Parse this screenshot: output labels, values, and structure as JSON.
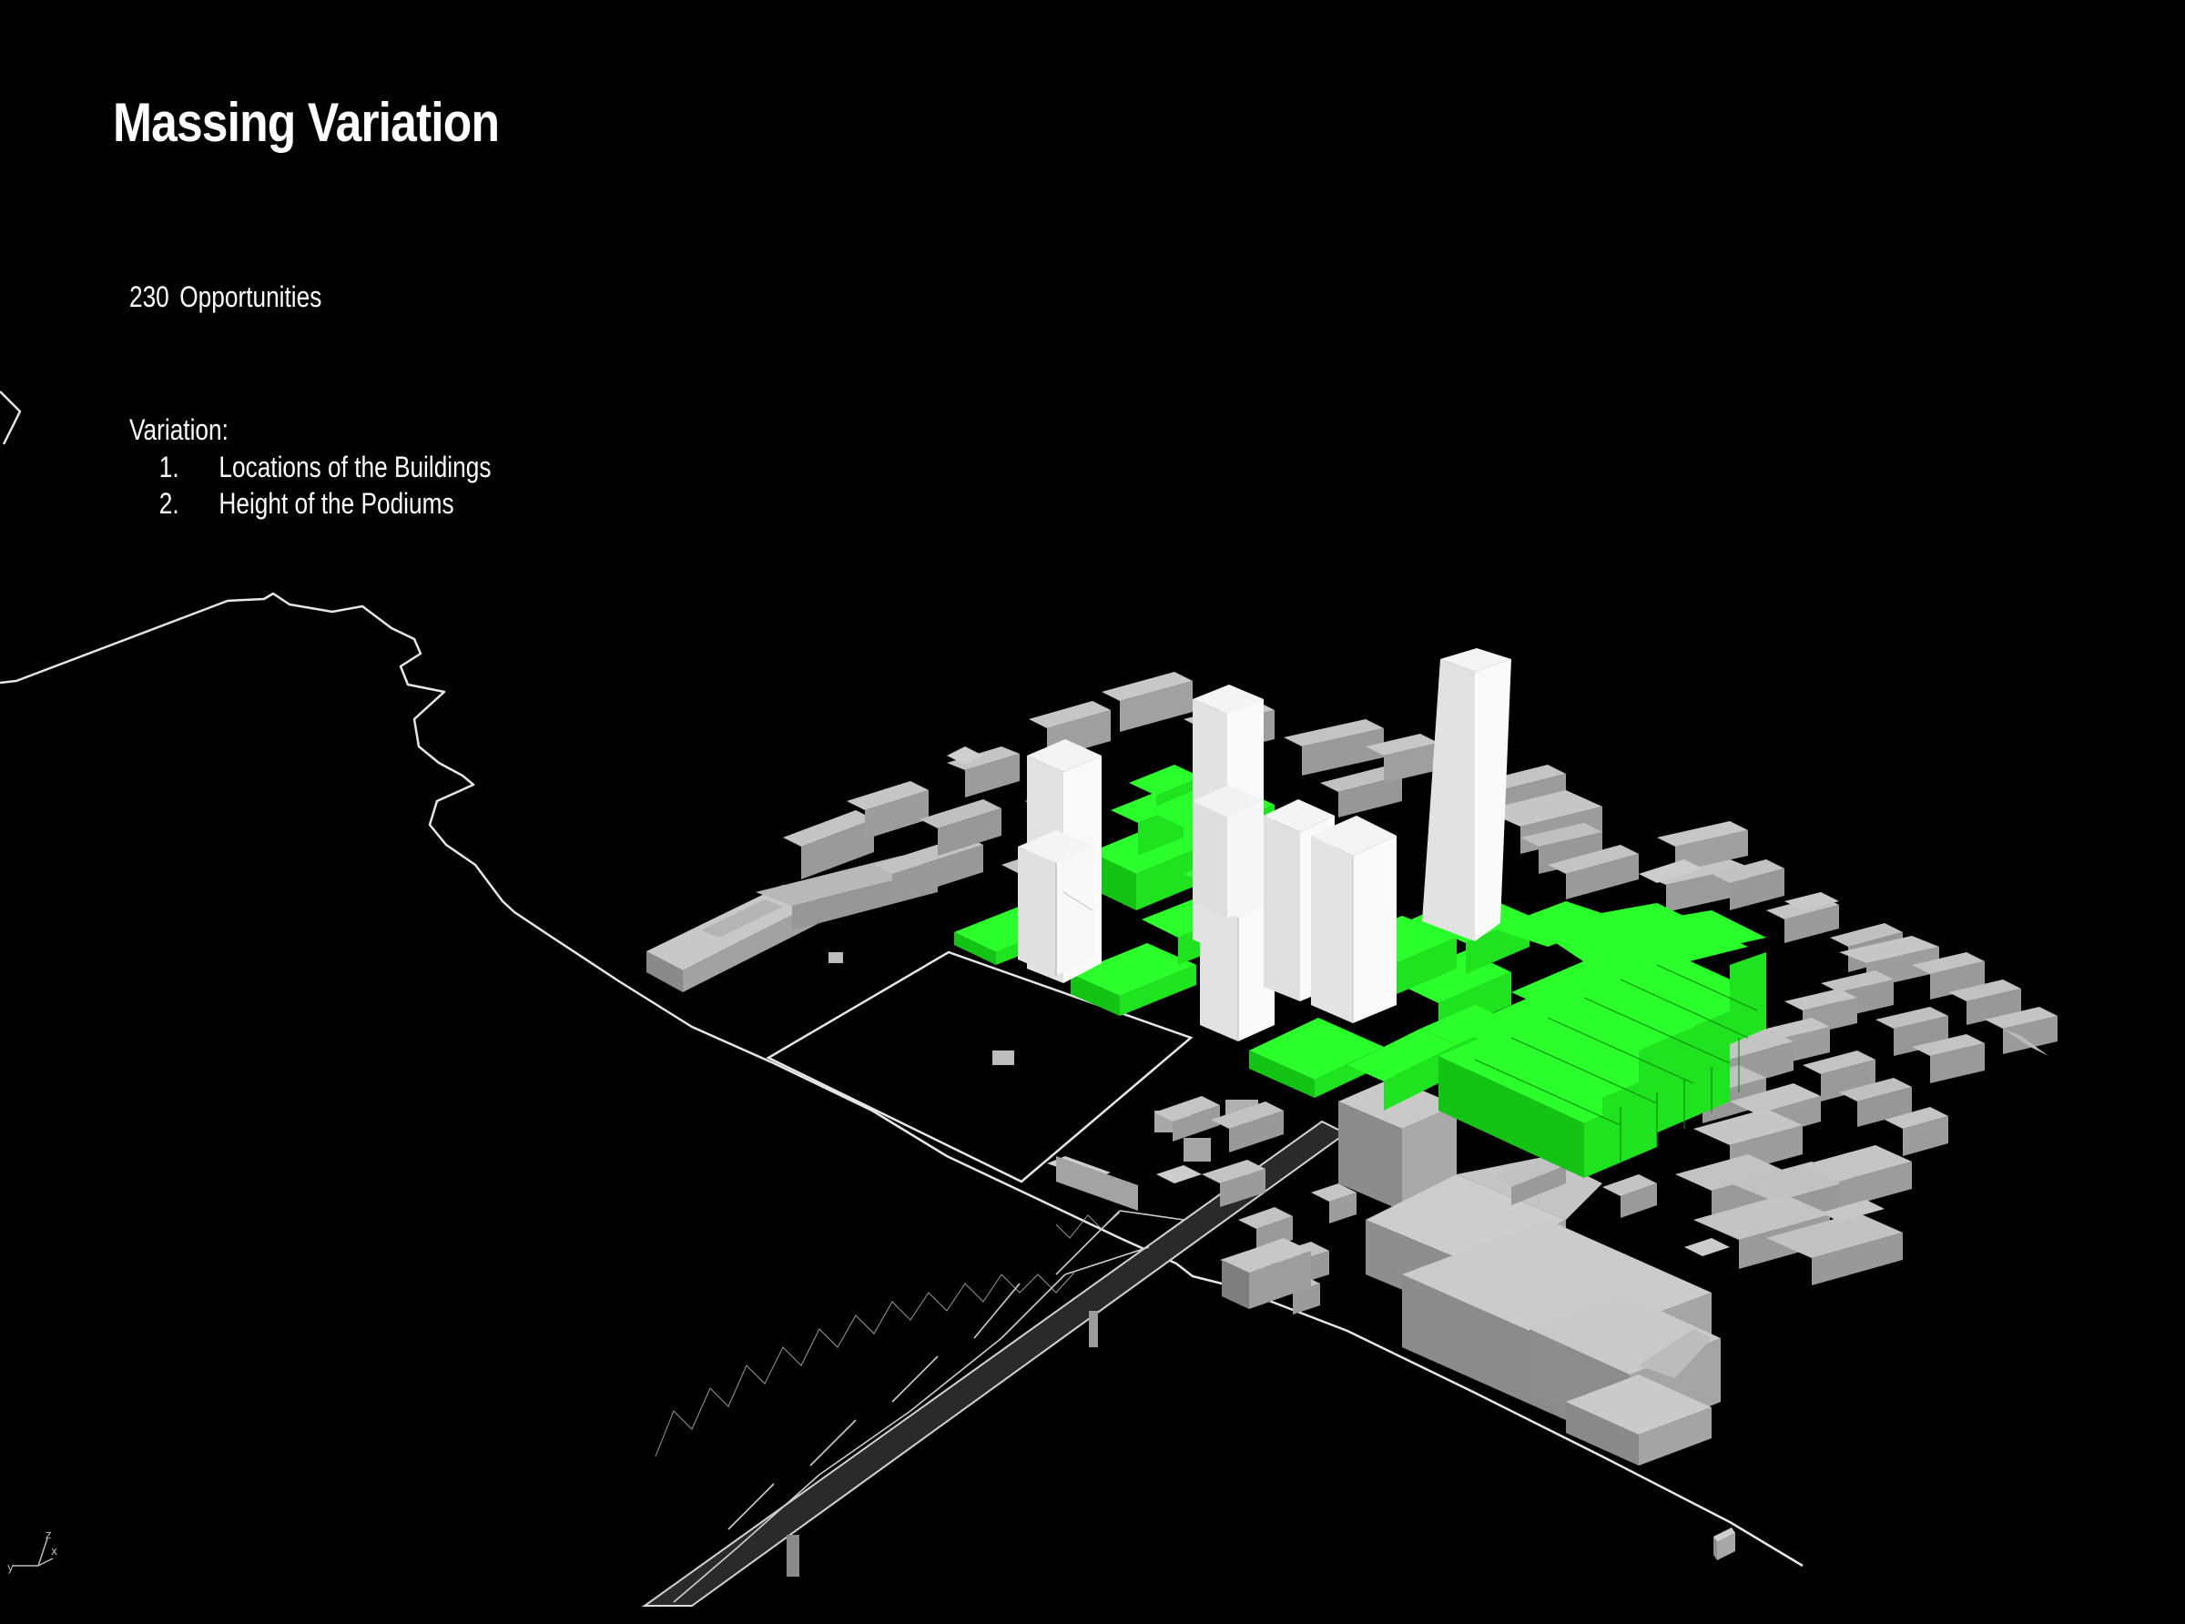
{
  "header": {
    "title": "Massing Variation"
  },
  "stats": {
    "count": "230",
    "label": "Opportunities"
  },
  "variation": {
    "heading": "Variation:",
    "items": [
      {
        "number": "1.",
        "label": "Locations of the Buildings"
      },
      {
        "number": "2.",
        "label": "Height of the Podiums"
      }
    ]
  },
  "axis_gizmo": {
    "z": "z",
    "x": "x",
    "y": "y"
  },
  "colors": {
    "background": "#000000",
    "context_buildings": "#a6a6a6",
    "podiums": "#22ff22",
    "towers": "#ffffff",
    "linework": "#e6e6e6"
  },
  "icons": {
    "axis": "xyz-axis-icon"
  }
}
